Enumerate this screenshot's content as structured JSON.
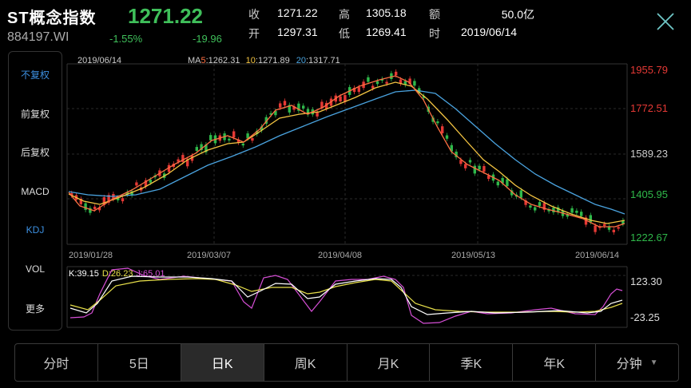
{
  "header": {
    "title": "ST概念指数",
    "code": "884197.WI",
    "price": "1271.22",
    "change_pct": "-1.55%",
    "change": "-19.96",
    "quote": [
      {
        "l1": "收",
        "v1": "1271.22",
        "l2": "高",
        "v2": "1305.18",
        "l3": "额",
        "v3": "50.0亿"
      },
      {
        "l1": "开",
        "v1": "1297.31",
        "l2": "低",
        "v2": "1269.41",
        "l3": "时",
        "v3": "2019/06/14"
      }
    ]
  },
  "sidebar": {
    "items": [
      "不复权",
      "前复权",
      "后复权",
      "MACD",
      "KDJ",
      "VOL",
      "更多"
    ],
    "active": [
      0,
      4
    ]
  },
  "main_chart": {
    "date": "2019/06/14",
    "ma_label": "MA",
    "ma5_key": "5",
    "ma5_val": ":1262.31",
    "ma10_key": "10",
    "ma10_val": ":1271.89",
    "ma20_key": "20",
    "ma20_val": ":1317.71",
    "y_ticks": [
      "1955.79",
      "1772.51",
      "1589.23",
      "1405.95",
      "1222.67"
    ],
    "x_ticks": [
      "2019/01/28",
      "2019/03/07",
      "2019/04/08",
      "2019/05/13",
      "2019/06/14"
    ]
  },
  "kdj": {
    "k": "K:39.15",
    "d": "D:26.23",
    "j": "J:65.01",
    "y_ticks": [
      "123.30",
      "-23.25"
    ]
  },
  "tabs": [
    "分时",
    "5日",
    "日K",
    "周K",
    "月K",
    "季K",
    "年K",
    "分钟"
  ],
  "active_tab": 2,
  "colors": {
    "up": "#e53935",
    "down": "#2fb84a",
    "ma5": "#ff7043",
    "ma10": "#f5c542",
    "ma20": "#4aa3df",
    "k": "#ffffff",
    "d": "#e8e04a",
    "j": "#d64fd6"
  },
  "chart_data": {
    "type": "candlestick",
    "ylim": [
      1222.67,
      1955.79
    ],
    "x": [
      "2019/01/28",
      "2019/03/07",
      "2019/04/08",
      "2019/05/13",
      "2019/06/14"
    ]
  }
}
